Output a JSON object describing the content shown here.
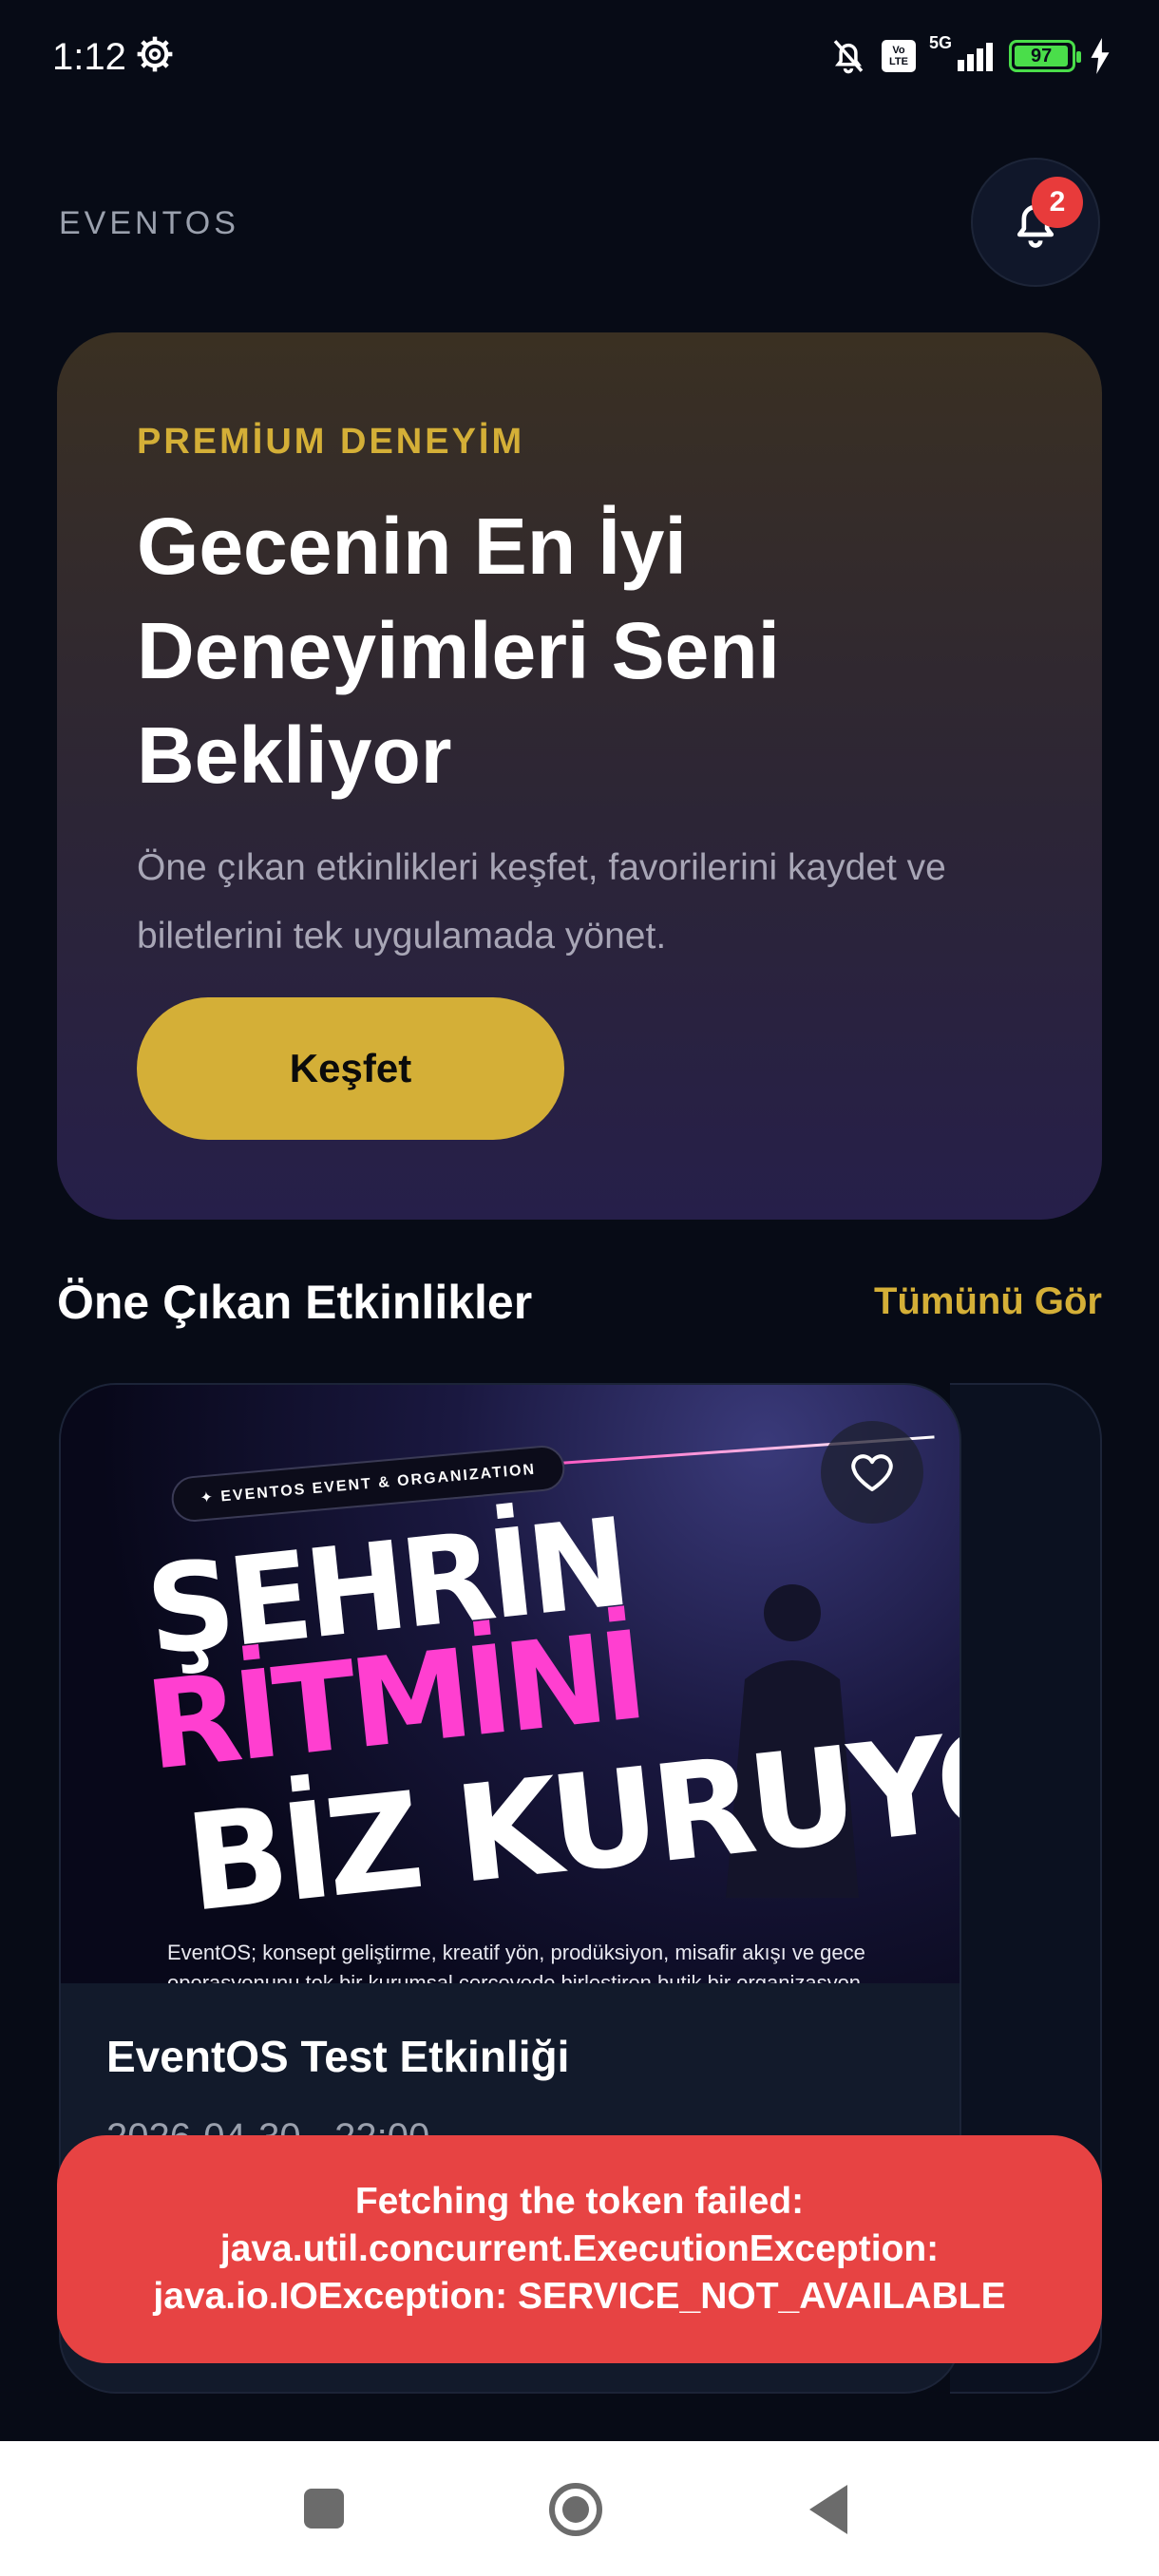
{
  "status_bar": {
    "time": "1:12",
    "network": "5G",
    "volte": "Vo LTE",
    "battery": "97"
  },
  "header": {
    "brand": "EVENTOS",
    "notification_count": "2"
  },
  "hero": {
    "kicker": "PREMİUM DENEYİM",
    "title": "Gecenin En İyi Deneyimleri Seni Bekliyor",
    "description": "Öne çıkan etkinlikleri keşfet, favorilerini kaydet ve biletlerini tek uygulamada yönet.",
    "button_label": "Keşfet"
  },
  "featured": {
    "title": "Öne Çıkan Etkinlikler",
    "see_all": "Tümünü Gör"
  },
  "event": {
    "image_pill": "✦ EVENTOS EVENT & ORGANIZATION",
    "image_line_1": "ŞEHRİN",
    "image_line_2": "RİTMİNİ",
    "image_line_3": "BİZ KURUYORUZ!",
    "image_caption": "EventOS; konsept geliştirme, kreatif yön, prodüksiyon, misafir akışı ve gece operasyonunu tek bir kurumsal çerçevede birleştiren butik bir organizasyon",
    "title": "EventOS Test Etkinliği",
    "date": "2026-04-30 · 22:00"
  },
  "toast": {
    "message": "Fetching the token failed: java.util.concurrent.ExecutionException: java.io.IOException: SERVICE_NOT_AVAILABLE"
  },
  "colors": {
    "background": "#070b16",
    "accent_gold": "#d4af37",
    "toast_red": "#e74343",
    "badge_red": "#e83b3b"
  }
}
